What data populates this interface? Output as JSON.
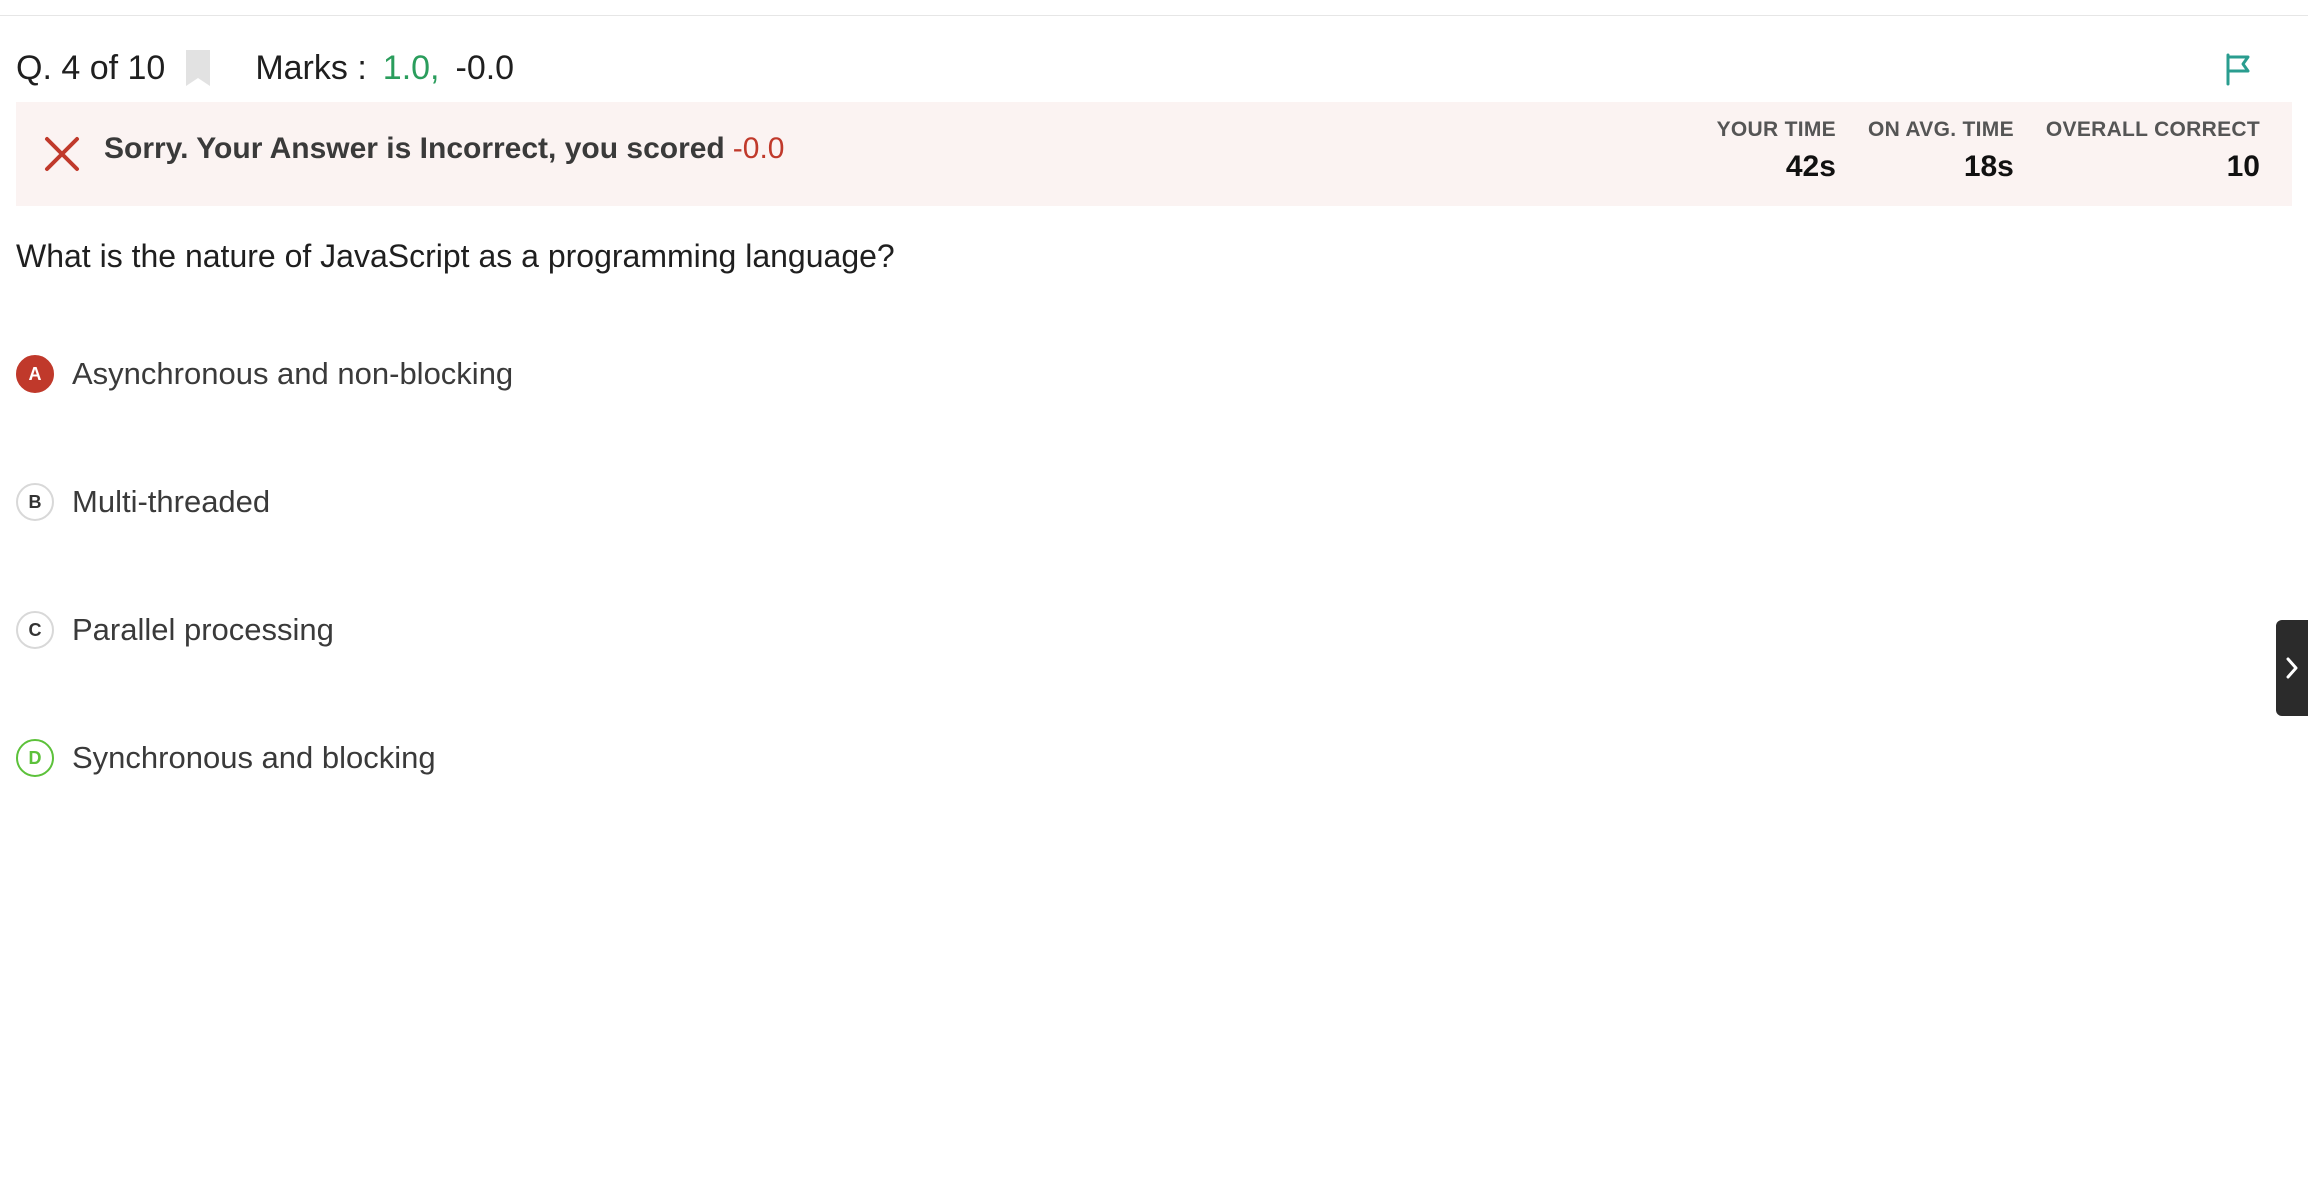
{
  "header": {
    "question_counter": "Q. 4 of 10",
    "marks_label": "Marks :",
    "marks_positive": "1.0,",
    "marks_negative": "-0.0"
  },
  "result": {
    "message": "Sorry. Your Answer is Incorrect, you scored",
    "score": "-0.0",
    "stats": [
      {
        "label": "YOUR TIME",
        "value": "42s"
      },
      {
        "label": "ON AVG. TIME",
        "value": "18s"
      },
      {
        "label": "OVERALL CORRECT",
        "value": "10"
      }
    ]
  },
  "question": {
    "text": "What is the nature of JavaScript as a programming language?"
  },
  "options": [
    {
      "letter": "A",
      "text": "Asynchronous and non-blocking",
      "state": "selected-wrong"
    },
    {
      "letter": "B",
      "text": "Multi-threaded",
      "state": "neutral"
    },
    {
      "letter": "C",
      "text": "Parallel processing",
      "state": "neutral"
    },
    {
      "letter": "D",
      "text": "Synchronous and blocking",
      "state": "marked-correct"
    }
  ],
  "icons": {
    "bookmark": "bookmark-icon",
    "flag": "flag-icon",
    "incorrect": "close-icon",
    "side_tab": "chevron-right-icon"
  },
  "colors": {
    "positive": "#2a9d5c",
    "negative": "#c0392b",
    "correct_option": "#5cc13a",
    "banner_bg": "#fbf3f2",
    "flag": "#2a9d8f"
  }
}
